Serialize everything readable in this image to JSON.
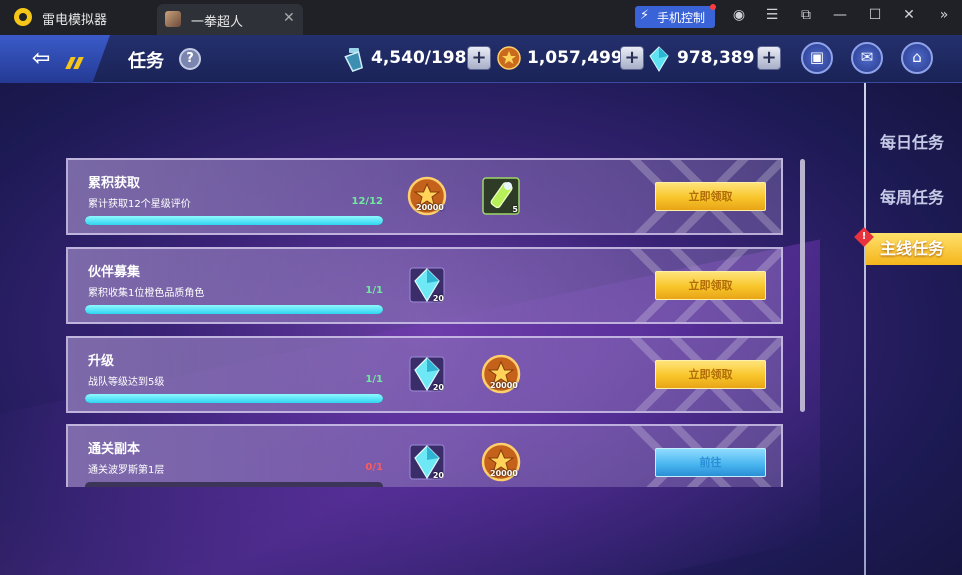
{
  "emulator": {
    "app_name": "雷电模拟器",
    "tab_title": "一拳超人",
    "tab_close": "✕",
    "phone_control_label": "手机控制",
    "phone_control_icon": "⚡",
    "window_buttons": [
      "◉",
      "☰",
      "⧉",
      "—",
      "☐",
      "✕",
      "»"
    ]
  },
  "header": {
    "back_arrow": "⇦",
    "title": "任务",
    "help": "?",
    "resources": [
      {
        "name": "stamina",
        "value": "4,540/198",
        "plus": "+"
      },
      {
        "name": "gold",
        "value": "1,057,499",
        "plus": "+"
      },
      {
        "name": "diamond",
        "value": "978,389",
        "plus": "+"
      }
    ],
    "icon_buttons": [
      {
        "name": "shop",
        "glyph": "▣"
      },
      {
        "name": "mail",
        "glyph": "✉"
      },
      {
        "name": "home",
        "glyph": "⌂"
      }
    ]
  },
  "tasks": [
    {
      "title": "累积获取",
      "desc": "累计获取12个星级评价",
      "progress_text": "12/12",
      "progress": 1.0,
      "progress_color": "#6fe9a0",
      "rewards": [
        {
          "type": "gold-coin",
          "qty": "20000"
        },
        {
          "type": "stamina-potion",
          "qty": "5"
        }
      ],
      "button": {
        "label": "立即领取",
        "style": "gold"
      }
    },
    {
      "title": "伙伴募集",
      "desc": "累积收集1位橙色品质角色",
      "progress_text": "1/1",
      "progress": 1.0,
      "progress_color": "#6fe9a0",
      "rewards": [
        {
          "type": "diamond",
          "qty": "20"
        }
      ],
      "button": {
        "label": "立即领取",
        "style": "gold"
      }
    },
    {
      "title": "升级",
      "desc": "战队等级达到5级",
      "progress_text": "1/1",
      "progress": 1.0,
      "progress_color": "#6fe9a0",
      "rewards": [
        {
          "type": "diamond",
          "qty": "20"
        },
        {
          "type": "gold-coin",
          "qty": "20000"
        }
      ],
      "button": {
        "label": "立即领取",
        "style": "gold"
      }
    },
    {
      "title": "通关副本",
      "desc": "通关波罗斯第1层",
      "progress_text": "0/1",
      "progress": 0.0,
      "progress_color": "#ff5a5a",
      "rewards": [
        {
          "type": "diamond",
          "qty": "20"
        },
        {
          "type": "gold-coin",
          "qty": "20000"
        }
      ],
      "button": {
        "label": "前往",
        "style": "blue"
      }
    }
  ],
  "side_tabs": [
    {
      "label": "每日任务",
      "active": false
    },
    {
      "label": "每周任务",
      "active": false
    },
    {
      "label": "主线任务",
      "active": true
    }
  ],
  "side_alert": "!",
  "colors": {
    "accent_gold": "#f8c52a",
    "progress_cyan": "#2fd5f0",
    "complete_green": "#6fe9a0",
    "incomplete_red": "#ff5a5a"
  }
}
